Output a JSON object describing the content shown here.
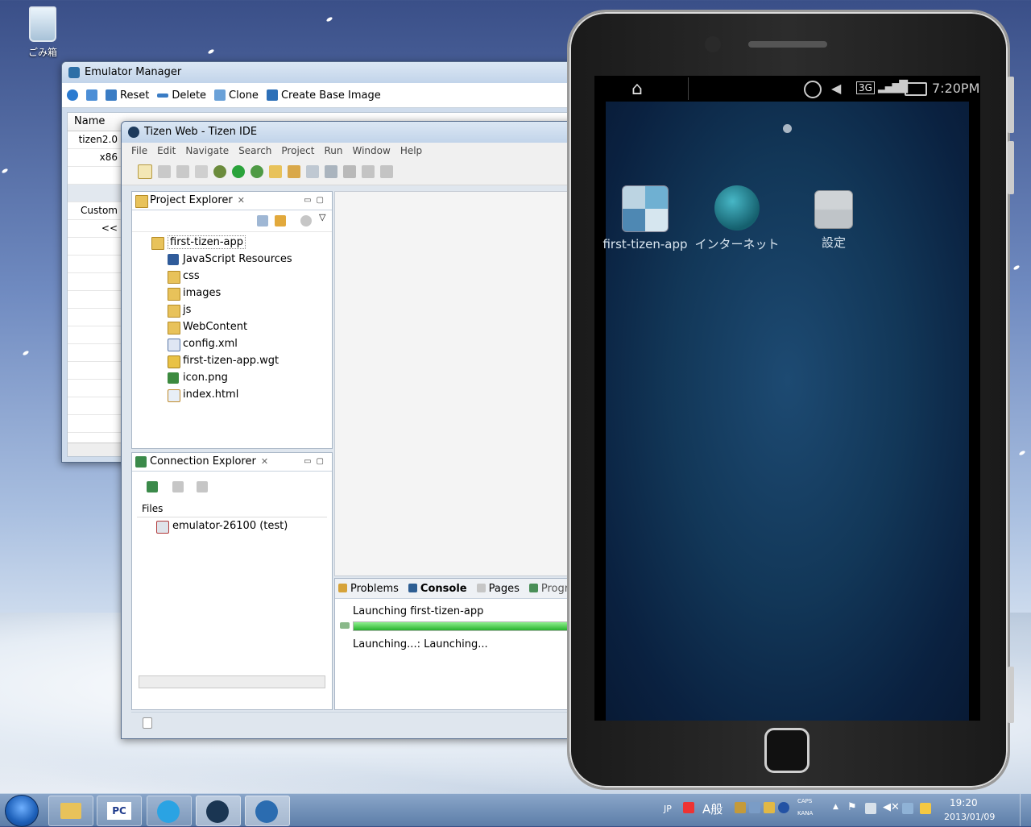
{
  "desktop": {
    "recycle_bin_label": "ごみ箱"
  },
  "emulator_manager": {
    "title": "Emulator Manager",
    "toolbar": {
      "reset": "Reset",
      "delete": "Delete",
      "clone": "Clone",
      "create_base_image": "Create Base Image"
    },
    "list_header": "Name",
    "rows": [
      "tizen2.0",
      "x86",
      "Custom",
      "<<"
    ]
  },
  "ide": {
    "title": "Tizen Web - Tizen IDE",
    "menu": [
      "File",
      "Edit",
      "Navigate",
      "Search",
      "Project",
      "Run",
      "Window",
      "Help"
    ],
    "project_explorer": {
      "tab_label": "Project Explorer",
      "root": "first-tizen-app",
      "children": [
        "JavaScript Resources",
        "css",
        "images",
        "js",
        "WebContent",
        "config.xml",
        "first-tizen-app.wgt",
        "icon.png",
        "index.html"
      ]
    },
    "connection_explorer": {
      "tab_label": "Connection Explorer",
      "files_header": "Files",
      "device": "emulator-26100 (test)"
    },
    "bottom_tabs": [
      "Problems",
      "Console",
      "Pages",
      "Progress"
    ],
    "progress": {
      "task_title": "Launching first-tizen-app",
      "status": "Launching...: Launching...",
      "fraction": 0.9
    }
  },
  "phone": {
    "time": "7:20PM",
    "network": "3G",
    "apps": [
      {
        "label": "first-tizen-app",
        "icon": "pinwheel-icon"
      },
      {
        "label": "インターネット",
        "icon": "globe-icon"
      },
      {
        "label": "設定",
        "icon": "settings-toggle-icon"
      }
    ]
  },
  "taskbar": {
    "ime_lang": "JP",
    "ime_mode": "A般",
    "caps": "CAPS",
    "kana": "KANA",
    "clock_time": "19:20",
    "clock_date": "2013/01/09"
  }
}
